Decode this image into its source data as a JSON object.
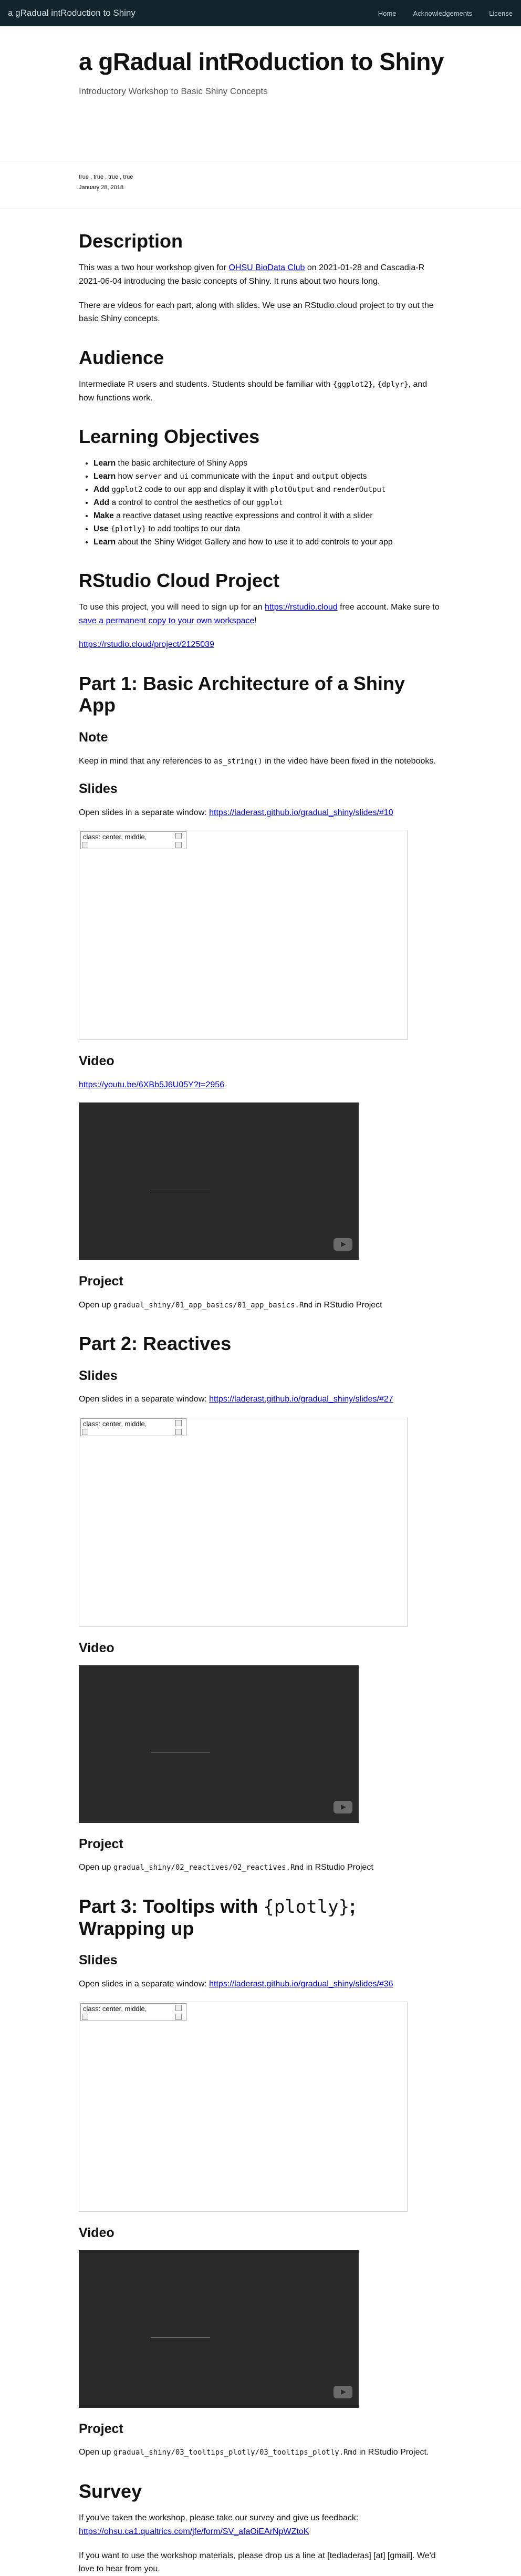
{
  "nav": {
    "brand": "a gRadual intRoduction to Shiny",
    "links": [
      "Home",
      "Acknowledgements",
      "License"
    ]
  },
  "hero": {
    "title": "a gRadual intRoduction to Shiny",
    "subtitle": "Introductory Workshop to Basic Shiny Concepts"
  },
  "meta": {
    "authors": "true , true , true , true",
    "date": "January 28, 2018"
  },
  "description": {
    "heading": "Description",
    "p1_before": "This was a two hour workshop given for ",
    "p1_link": "OHSU BioData Club",
    "p1_after": " on 2021-01-28 and Cascadia-R 2021-06-04 introducing the basic concepts of Shiny. It runs about two hours long.",
    "p2": "There are videos for each part, along with slides. We use an RStudio.cloud project to try out the basic Shiny concepts."
  },
  "audience": {
    "heading": "Audience",
    "p_before": "Intermediate R users and students. Students should be familiar with ",
    "code1": "{ggplot2}",
    "p_mid": ", ",
    "code2": "{dplyr}",
    "p_after": ", and how functions work."
  },
  "objectives": {
    "heading": "Learning Objectives",
    "items": [
      {
        "bold": "Learn",
        "parts": [
          " the basic architecture of Shiny Apps"
        ]
      },
      {
        "bold": "Learn",
        "parts": [
          " how ",
          "server",
          " and ",
          "ui",
          " communicate with the ",
          "input",
          " and ",
          "output",
          " objects"
        ]
      },
      {
        "bold": "Add",
        "parts": [
          " ",
          "ggplot2",
          " code to our app and display it with ",
          "plotOutput",
          " and ",
          "renderOutput"
        ]
      },
      {
        "bold": "Add",
        "parts": [
          " a control to control the aesthetics of our ",
          "ggplot"
        ]
      },
      {
        "bold": "Make",
        "parts": [
          " a reactive dataset using reactive expressions and control it with a slider"
        ]
      },
      {
        "bold": "Use",
        "parts": [
          " ",
          "{plotly}",
          " to add tooltips to our data"
        ]
      },
      {
        "bold": "Learn",
        "parts": [
          " about the Shiny Widget Gallery and how to use it to add controls to your app"
        ]
      }
    ]
  },
  "cloud": {
    "heading": "RStudio Cloud Project",
    "p1_before": "To use this project, you will need to sign up for an ",
    "p1_link": "https://rstudio.cloud",
    "p1_mid": " free account. Make sure to ",
    "p1_link2": "save a permanent copy to your own workspace",
    "p1_after": "!",
    "project_link": "https://rstudio.cloud/project/2125039"
  },
  "part1": {
    "heading": "Part 1: Basic Architecture of a Shiny App",
    "note_heading": "Note",
    "note_before": "Keep in mind that any references to ",
    "note_code": "as_string()",
    "note_after": " in the video have been fixed in the notebooks.",
    "slides_heading": "Slides",
    "slides_text": "Open slides in a separate window: ",
    "slides_link": "https://laderast.github.io/gradual_shiny/slides/#10",
    "slide_badge": "class: center, middle,",
    "video_heading": "Video",
    "video_link": "https://youtu.be/6XBb5J6U05Y?t=2956",
    "project_heading": "Project",
    "project_before": "Open up ",
    "project_code": "gradual_shiny/01_app_basics/01_app_basics.Rmd",
    "project_after": " in RStudio Project"
  },
  "part2": {
    "heading": "Part 2: Reactives",
    "slides_heading": "Slides",
    "slides_text": "Open slides in a separate window: ",
    "slides_link": "https://laderast.github.io/gradual_shiny/slides/#27",
    "slide_badge": "class: center, middle,",
    "video_heading": "Video",
    "project_heading": "Project",
    "project_before": "Open up ",
    "project_code": "gradual_shiny/02_reactives/02_reactives.Rmd",
    "project_after": " in RStudio Project"
  },
  "part3": {
    "heading_before": "Part 3: Tooltips with ",
    "heading_code": "{plotly}",
    "heading_after": "; Wrapping up",
    "slides_heading": "Slides",
    "slides_text": "Open slides in a separate window: ",
    "slides_link": "https://laderast.github.io/gradual_shiny/slides/#36",
    "slide_badge": "class: center, middle,",
    "video_heading": "Video",
    "project_heading": "Project",
    "project_before": "Open up ",
    "project_code": "gradual_shiny/03_tooltips_plotly/03_tooltips_plotly.Rmd",
    "project_after": " in RStudio Project."
  },
  "survey": {
    "heading": "Survey",
    "p1": "If you've taken the workshop, please take our survey and give us feedback:",
    "link": "https://ohsu.ca1.qualtrics.com/jfe/form/SV_afaOiEArNpWZtoK",
    "p2": "If you want to use the workshop materials, please drop us a line at [tedladeras] [at] [gmail]. We'd love to hear from you."
  }
}
